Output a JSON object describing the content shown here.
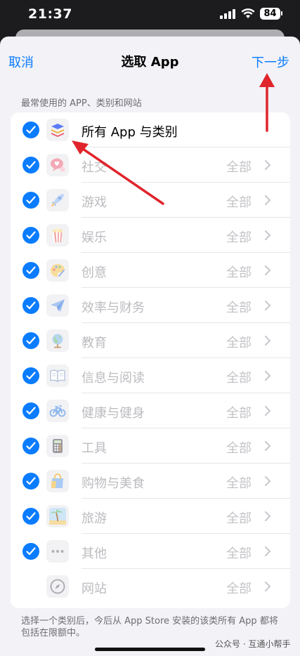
{
  "status_bar": {
    "time": "21:37",
    "battery": "84"
  },
  "nav": {
    "cancel": "取消",
    "title": "选取 App",
    "next": "下一步"
  },
  "section_header": "最常使用的 APP、类别和网站",
  "rows": [
    {
      "label": "所有 App 与类别",
      "value": "",
      "icon": "stack-layers-icon",
      "checked": true
    },
    {
      "label": "社交",
      "value": "全部",
      "icon": "chat-bubble-heart-icon",
      "checked": true
    },
    {
      "label": "游戏",
      "value": "全部",
      "icon": "rocket-icon",
      "checked": true
    },
    {
      "label": "娱乐",
      "value": "全部",
      "icon": "popcorn-icon",
      "checked": true
    },
    {
      "label": "创意",
      "value": "全部",
      "icon": "palette-icon",
      "checked": true
    },
    {
      "label": "效率与财务",
      "value": "全部",
      "icon": "paper-plane-icon",
      "checked": true
    },
    {
      "label": "教育",
      "value": "全部",
      "icon": "globe-icon",
      "checked": true
    },
    {
      "label": "信息与阅读",
      "value": "全部",
      "icon": "book-icon",
      "checked": true
    },
    {
      "label": "健康与健身",
      "value": "全部",
      "icon": "bicycle-icon",
      "checked": true
    },
    {
      "label": "工具",
      "value": "全部",
      "icon": "calculator-icon",
      "checked": true
    },
    {
      "label": "购物与美食",
      "value": "全部",
      "icon": "shopping-bag-icon",
      "checked": true
    },
    {
      "label": "旅游",
      "value": "全部",
      "icon": "palm-tree-icon",
      "checked": true
    },
    {
      "label": "其他",
      "value": "全部",
      "icon": "ellipsis-icon",
      "checked": true
    },
    {
      "label": "网站",
      "value": "全部",
      "icon": "compass-icon",
      "checked": false
    }
  ],
  "footer_note": "选择一个类别后，今后从 App Store 安装的该类所有 App 都将包括在限额中。",
  "watermark": "公众号 · 互通小帮手",
  "colors": {
    "accent": "#0a7cff",
    "annotation_arrow": "#e0242b"
  }
}
